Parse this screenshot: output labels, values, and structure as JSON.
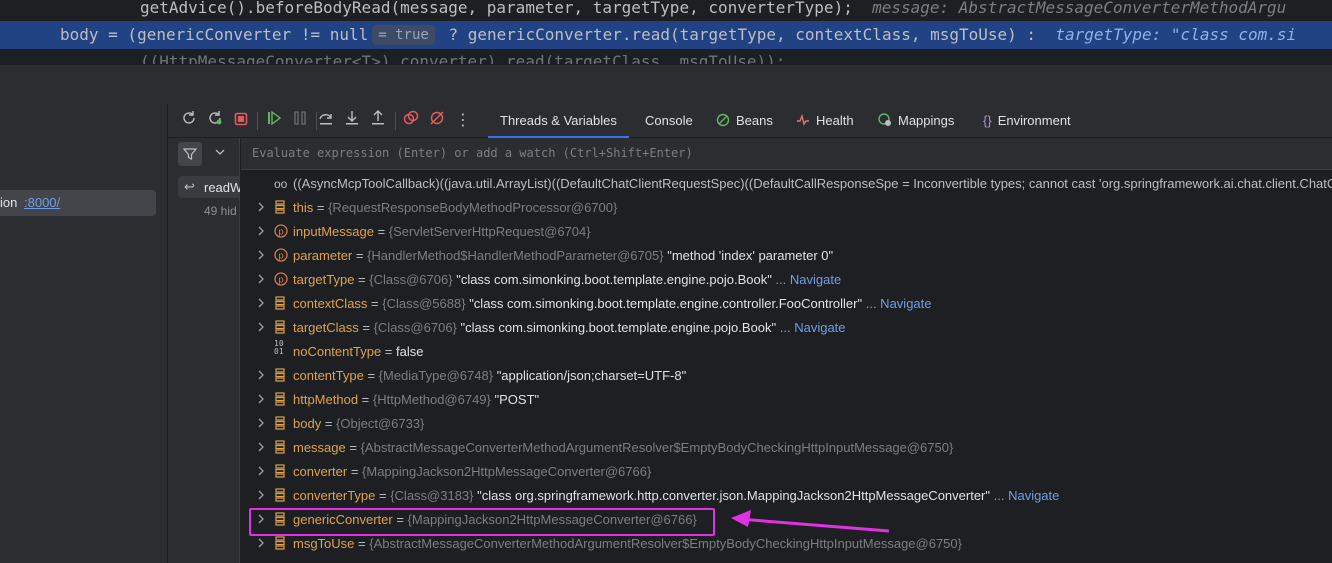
{
  "editor": {
    "line1": {
      "call": "getAdvice().beforeBodyRead(message, parameter, targetType, converterType);",
      "hint": "message: AbstractMessageConverterMethodArgu"
    },
    "line2": {
      "prefix": "body = (genericConverter != null",
      "badge": "= true",
      "suffix": " ? genericConverter.read(targetType, contextClass, msgToUse) :",
      "hint": "targetType: \"class com.si"
    },
    "line3": {
      "text": "((HttpMessageConverter<T>) converter).read(targetClass, msgToUse));"
    }
  },
  "frames": {
    "selected_label": "ion",
    "selected_link": ":8000/"
  },
  "threads": {
    "item_label": "readW",
    "hidden_label": "49 hid"
  },
  "toolbar": {
    "icons": [
      "rerun-icon",
      "restart-icon",
      "stop-icon",
      "resume-icon",
      "pause-icon",
      "step-over-icon",
      "step-into-icon",
      "step-out-icon",
      "view-breakpoints-icon",
      "mute-breakpoints-icon",
      "more-icon"
    ],
    "tabs": [
      {
        "label": "Threads & Variables",
        "active": true
      },
      {
        "label": "Console"
      },
      {
        "label": "Beans"
      },
      {
        "label": "Health"
      },
      {
        "label": "Mappings"
      },
      {
        "label": "Environment"
      }
    ]
  },
  "eval_placeholder": "Evaluate expression (Enter) or add a watch (Ctrl+Shift+Enter)",
  "watch_row": "((AsyncMcpToolCallback)((java.util.ArrayList)((DefaultChatClientRequestSpec)((DefaultCallResponseSpe = Inconvertible types; cannot cast 'org.springframework.ai.chat.client.ChatClie",
  "variables": [
    {
      "name": "this",
      "kind": "field",
      "type": "{RequestResponseBodyMethodProcessor@6700}",
      "value": "",
      "nav": ""
    },
    {
      "name": "inputMessage",
      "kind": "param",
      "type": "{ServletServerHttpRequest@6704}",
      "value": "",
      "nav": ""
    },
    {
      "name": "parameter",
      "kind": "param",
      "type": "{HandlerMethod$HandlerMethodParameter@6705}",
      "value": "\"method 'index' parameter 0\"",
      "nav": ""
    },
    {
      "name": "targetType",
      "kind": "param",
      "type": "{Class@6706}",
      "value": "\"class com.simonking.boot.template.engine.pojo.Book\"",
      "nav": "... Navigate"
    },
    {
      "name": "contextClass",
      "kind": "field",
      "type": "{Class@5688}",
      "value": "\"class com.simonking.boot.template.engine.controller.FooController\"",
      "nav": "... Navigate"
    },
    {
      "name": "targetClass",
      "kind": "field",
      "type": "{Class@6706}",
      "value": "\"class com.simonking.boot.template.engine.pojo.Book\"",
      "nav": "... Navigate"
    },
    {
      "name": "noContentType",
      "kind": "bool",
      "type": "",
      "value": "false",
      "nav": ""
    },
    {
      "name": "contentType",
      "kind": "field",
      "type": "{MediaType@6748}",
      "value": "\"application/json;charset=UTF-8\"",
      "nav": ""
    },
    {
      "name": "httpMethod",
      "kind": "field",
      "type": "{HttpMethod@6749}",
      "value": "\"POST\"",
      "nav": ""
    },
    {
      "name": "body",
      "kind": "field",
      "type": "{Object@6733}",
      "value": "",
      "nav": ""
    },
    {
      "name": "message",
      "kind": "field",
      "type": "{AbstractMessageConverterMethodArgumentResolver$EmptyBodyCheckingHttpInputMessage@6750}",
      "value": "",
      "nav": ""
    },
    {
      "name": "converter",
      "kind": "field",
      "type": "{MappingJackson2HttpMessageConverter@6766}",
      "value": "",
      "nav": ""
    },
    {
      "name": "converterType",
      "kind": "field",
      "type": "{Class@3183}",
      "value": "\"class org.springframework.http.converter.json.MappingJackson2HttpMessageConverter\"",
      "nav": "... Navigate"
    },
    {
      "name": "genericConverter",
      "kind": "field",
      "type": "{MappingJackson2HttpMessageConverter@6766}",
      "value": "",
      "nav": "",
      "highlighted": true
    },
    {
      "name": "msgToUse",
      "kind": "field",
      "type": "{AbstractMessageConverterMethodArgumentResolver$EmptyBodyCheckingHttpInputMessage@6750}",
      "value": "",
      "nav": ""
    }
  ],
  "colors": {
    "highlight_box": "#e031e3",
    "arrow": "#e031e3",
    "active_tab_underline": "#3574f0",
    "selected_line": "#214283"
  }
}
